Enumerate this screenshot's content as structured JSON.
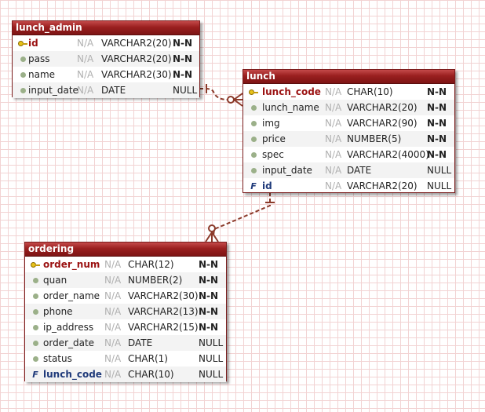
{
  "entities": {
    "lunch_admin": {
      "title": "lunch_admin",
      "rows": [
        {
          "icon": "primary-key-icon",
          "name": "id",
          "nullable": "N/A",
          "type": "VARCHAR2(20)",
          "constraint": "N-N"
        },
        {
          "icon": "column-dot-icon",
          "name": "pass",
          "nullable": "N/A",
          "type": "VARCHAR2(20)",
          "constraint": "N-N"
        },
        {
          "icon": "column-dot-icon",
          "name": "name",
          "nullable": "N/A",
          "type": "VARCHAR2(30)",
          "constraint": "N-N"
        },
        {
          "icon": "column-dot-icon",
          "name": "input_date",
          "nullable": "N/A",
          "type": "DATE",
          "constraint": "NULL"
        }
      ]
    },
    "lunch": {
      "title": "lunch",
      "rows": [
        {
          "icon": "primary-key-icon",
          "name": "lunch_code",
          "nullable": "N/A",
          "type": "CHAR(10)",
          "constraint": "N-N"
        },
        {
          "icon": "column-dot-icon",
          "name": "lunch_name",
          "nullable": "N/A",
          "type": "VARCHAR2(20)",
          "constraint": "N-N"
        },
        {
          "icon": "column-dot-icon",
          "name": "img",
          "nullable": "N/A",
          "type": "VARCHAR2(90)",
          "constraint": "N-N"
        },
        {
          "icon": "column-dot-icon",
          "name": "price",
          "nullable": "N/A",
          "type": "NUMBER(5)",
          "constraint": "N-N"
        },
        {
          "icon": "column-dot-icon",
          "name": "spec",
          "nullable": "N/A",
          "type": "VARCHAR2(4000)",
          "constraint": "N-N"
        },
        {
          "icon": "column-dot-icon",
          "name": "input_date",
          "nullable": "N/A",
          "type": "DATE",
          "constraint": "NULL"
        },
        {
          "icon": "foreign-key-icon",
          "name": "id",
          "nullable": "N/A",
          "type": "VARCHAR2(20)",
          "constraint": "NULL"
        }
      ]
    },
    "ordering": {
      "title": "ordering",
      "rows": [
        {
          "icon": "primary-key-icon",
          "name": "order_num",
          "nullable": "N/A",
          "type": "CHAR(12)",
          "constraint": "N-N"
        },
        {
          "icon": "column-dot-icon",
          "name": "quan",
          "nullable": "N/A",
          "type": "NUMBER(2)",
          "constraint": "N-N"
        },
        {
          "icon": "column-dot-icon",
          "name": "order_name",
          "nullable": "N/A",
          "type": "VARCHAR2(30)",
          "constraint": "N-N"
        },
        {
          "icon": "column-dot-icon",
          "name": "phone",
          "nullable": "N/A",
          "type": "VARCHAR2(13)",
          "constraint": "N-N"
        },
        {
          "icon": "column-dot-icon",
          "name": "ip_address",
          "nullable": "N/A",
          "type": "VARCHAR2(15)",
          "constraint": "N-N"
        },
        {
          "icon": "column-dot-icon",
          "name": "order_date",
          "nullable": "N/A",
          "type": "DATE",
          "constraint": "NULL"
        },
        {
          "icon": "column-dot-icon",
          "name": "status",
          "nullable": "N/A",
          "type": "CHAR(1)",
          "constraint": "NULL"
        },
        {
          "icon": "foreign-key-icon",
          "name": "lunch_code",
          "nullable": "N/A",
          "type": "CHAR(10)",
          "constraint": "NULL"
        }
      ]
    }
  },
  "colors": {
    "title_bar": "#8b1a1a",
    "relationship_line": "#8b3a2a",
    "grid": "#f2d3d3",
    "primary_key_text": "#9b1212",
    "foreign_key_text": "#1f3a7a"
  },
  "relationships": [
    {
      "from": "lunch_admin",
      "to": "lunch",
      "style": "dashed",
      "from_end": "one",
      "to_end": "zero-or-many"
    },
    {
      "from": "lunch",
      "to": "ordering",
      "style": "dashed",
      "from_end": "one",
      "to_end": "zero-or-many"
    }
  ]
}
